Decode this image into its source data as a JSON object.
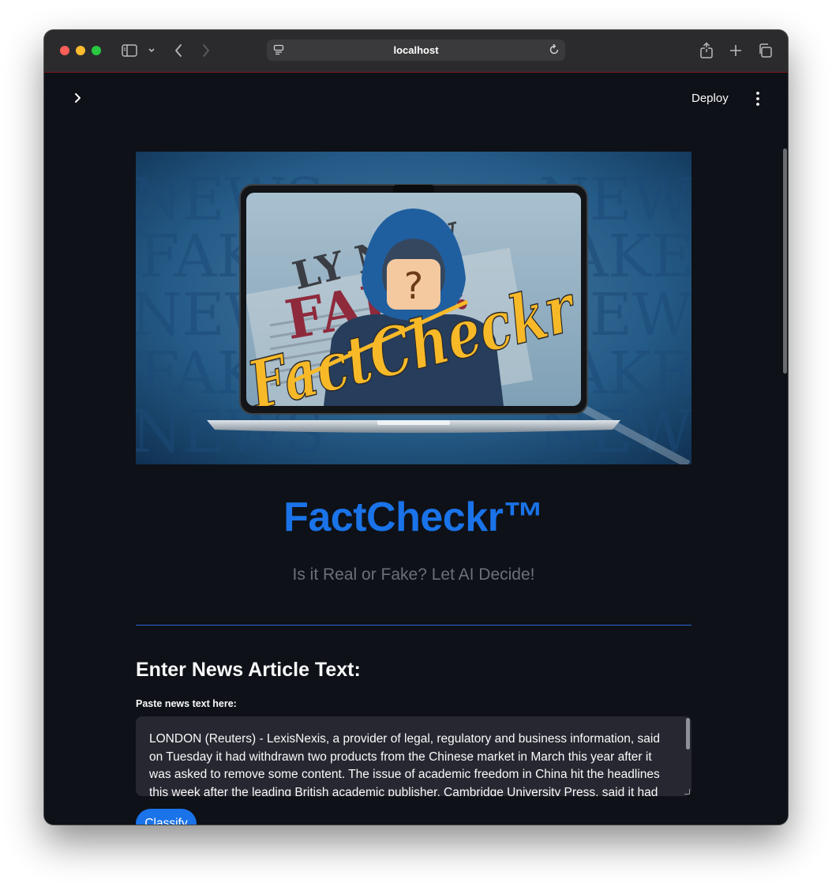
{
  "browser": {
    "url": "localhost",
    "icons": [
      "sidebar-icon",
      "chevron-down-icon",
      "back-icon",
      "forward-icon",
      "site-settings-icon",
      "reload-icon",
      "share-icon",
      "new-tab-icon",
      "tabs-overview-icon"
    ]
  },
  "app": {
    "toolbar": {
      "deploy_label": "Deploy"
    },
    "hero": {
      "background_words": [
        "NEWS",
        "FAKE"
      ],
      "newspaper_text": "LY NEW",
      "stamp_text": "FAKE!",
      "logo_text": "FactCheckr",
      "question_mark": "?"
    },
    "title": "FactCheckr™",
    "subtitle": "Is it Real or Fake? Let AI Decide!",
    "input_section": {
      "heading": "Enter News Article Text:",
      "label": "Paste news text here:",
      "value": "LONDON (Reuters) - LexisNexis, a provider of legal, regulatory and business information, said on Tuesday it had withdrawn two products from the Chinese market in March this year after it was asked to remove some content.  The issue of academic freedom in China hit the headlines this week after the leading British academic publisher, Cambridge University Press, said it had complied with"
    },
    "classify_label": "Classify"
  },
  "colors": {
    "app_background": "#0e1117",
    "accent": "#1a73e8",
    "text": "#fafafa",
    "subtitle": "#6b7079",
    "input_background": "#262730"
  }
}
